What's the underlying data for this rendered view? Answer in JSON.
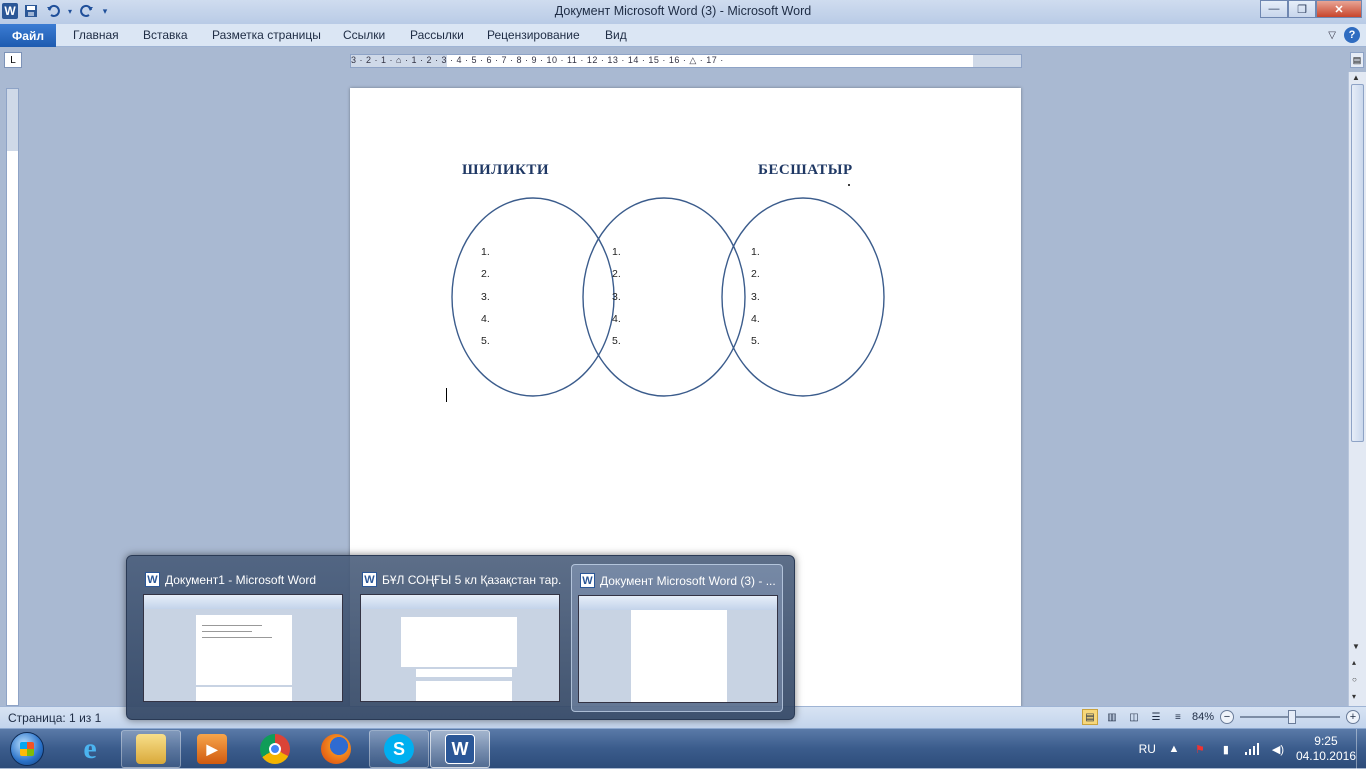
{
  "window": {
    "title": "Документ Microsoft Word (3)  -  Microsoft Word",
    "app_icon": "W",
    "controls": {
      "minimize": "—",
      "maximize": "❐",
      "close": "✕"
    }
  },
  "quick_access": {
    "save": "save-icon",
    "undo": "undo-icon",
    "redo": "redo-icon",
    "customize": "▾"
  },
  "ribbon": {
    "file_tab": "Файл",
    "tabs": [
      "Главная",
      "Вставка",
      "Разметка страницы",
      "Ссылки",
      "Рассылки",
      "Рецензирование",
      "Вид"
    ],
    "help": "?",
    "minimize": "▽"
  },
  "ruler": {
    "tab_selector": "L",
    "numbers": "3 · 2 · 1 · ⌂ · 1 · 2 · 3 · 4 · 5 · 6 · 7 · 8 · 9 · 10 · 11 · 12 · 13 · 14 · 15 · 16 · △ · 17 ·"
  },
  "document": {
    "heading_left": "ШИЛИКТИ",
    "heading_right": "БЕСШАТЫР",
    "circles": [
      {
        "items": [
          "1.",
          "2.",
          "3.",
          "4.",
          "5."
        ]
      },
      {
        "items": [
          "1.",
          "2.",
          "3.",
          "4.",
          "5."
        ]
      },
      {
        "items": [
          "1.",
          "2.",
          "3.",
          "4.",
          "5."
        ]
      }
    ],
    "venn_stroke": "#3b5c8c"
  },
  "statusbar": {
    "page": "Страница: 1 из 1",
    "zoom": "84%",
    "zoom_minus": "−",
    "zoom_plus": "+"
  },
  "preview": {
    "items": [
      {
        "title": "Документ1 - Microsoft Word",
        "icon": "W"
      },
      {
        "title": "БҰЛ СОҢҒЫ 5 кл Қазақстан тар...",
        "icon": "W"
      },
      {
        "title": "Документ Microsoft Word (3) - ...",
        "icon": "W"
      }
    ]
  },
  "taskbar": {
    "apps": [
      "explorer-icon",
      "internet-explorer-icon",
      "file-explorer-icon",
      "media-player-icon",
      "chrome-icon",
      "firefox-icon",
      "skype-icon",
      "word-icon"
    ],
    "ie_glyph": "e",
    "skype_glyph": "S",
    "word_glyph": "W",
    "language": "RU",
    "time": "9:25",
    "date": "04.10.2016"
  }
}
